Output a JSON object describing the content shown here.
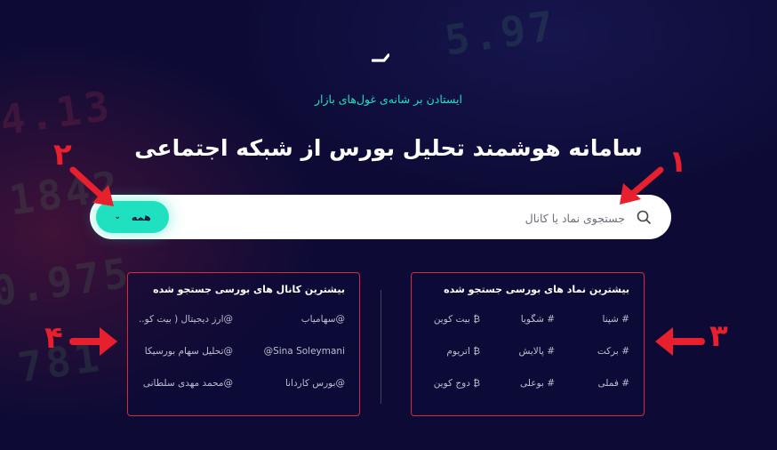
{
  "hero": {
    "tagline": "ایستادن بر شانه‌ی غول‌های بازار",
    "title": "سامانه هوشمند تحلیل بورس از شبکه اجتماعی"
  },
  "search": {
    "placeholder": "جستجوی نماد یا کانال",
    "filter_label": "همه"
  },
  "top_channels": {
    "title": "بیشترین کانال های بورسی جستجو شده",
    "items": [
      "@سهامیاب",
      "@ارز دیجیتال ( بیت کو...",
      "Sina Soleymani@",
      "@تحلیل سهام بورسیکا",
      "@بورس کاردانا",
      "@محمد مهدی سلطانی"
    ]
  },
  "top_symbols": {
    "title": "بیشترین نماد های بورسی جستجو شده",
    "items": [
      "# شپنا",
      "# شگویا",
      "₿ بیت کوین",
      "# برکت",
      "# پالایش",
      "₿ اتریوم",
      "# فملی",
      "# بوعلی",
      "₿ دوج کوین"
    ]
  },
  "annotations": {
    "n1": "۱",
    "n2": "۲",
    "n3": "۳",
    "n4": "۴"
  },
  "colors": {
    "background": "#0d0b36",
    "accent": "#1fe1c0",
    "annotation_red": "#e8202e",
    "panel_border": "#d8283c"
  }
}
